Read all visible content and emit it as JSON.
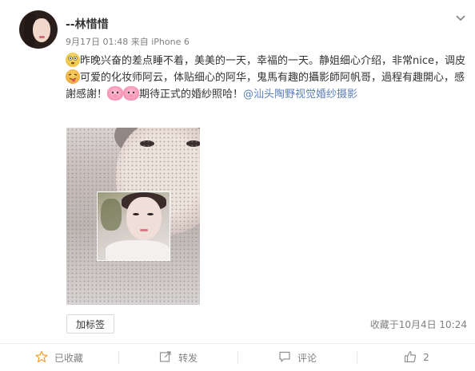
{
  "post": {
    "username": "--林惜惜",
    "meta": {
      "date_time": "9月17日 01:48",
      "source_prefix": "来自",
      "source": "iPhone 6"
    },
    "content": {
      "seg1": "昨晚兴奋的差点睡不着，美美的一天，幸福的一天。静姐细心介绍，非常nice，调皮",
      "seg2": "可爱的化妆师阿云，体贴细心的阿华，鬼馬有趣的攝影師阿帆哥，過程有趣開心，感謝感謝！",
      "seg3": "期待正式的婚紗照哈！",
      "mention": "@汕头陶野视觉婚纱摄影"
    },
    "tag_button": "加标签",
    "favorited_time": "收藏于10月4日 10:24"
  },
  "actions": [
    {
      "icon": "star-icon",
      "label": "已收藏"
    },
    {
      "icon": "forward-icon",
      "label": "转发"
    },
    {
      "icon": "comment-icon",
      "label": "评论"
    },
    {
      "icon": "thumbs-up-icon",
      "label": "2"
    }
  ],
  "icons": {
    "emoji_sleepy": "sleepy-emoji-icon",
    "emoji_tongue": "tongue-emoji-icon",
    "emoji_pig": "pig-emoji-icon",
    "dropdown": "chevron-down-icon"
  },
  "colors": {
    "username": "#333333",
    "meta": "#808080",
    "link": "#5b7fb5",
    "star": "#f2a53a"
  }
}
